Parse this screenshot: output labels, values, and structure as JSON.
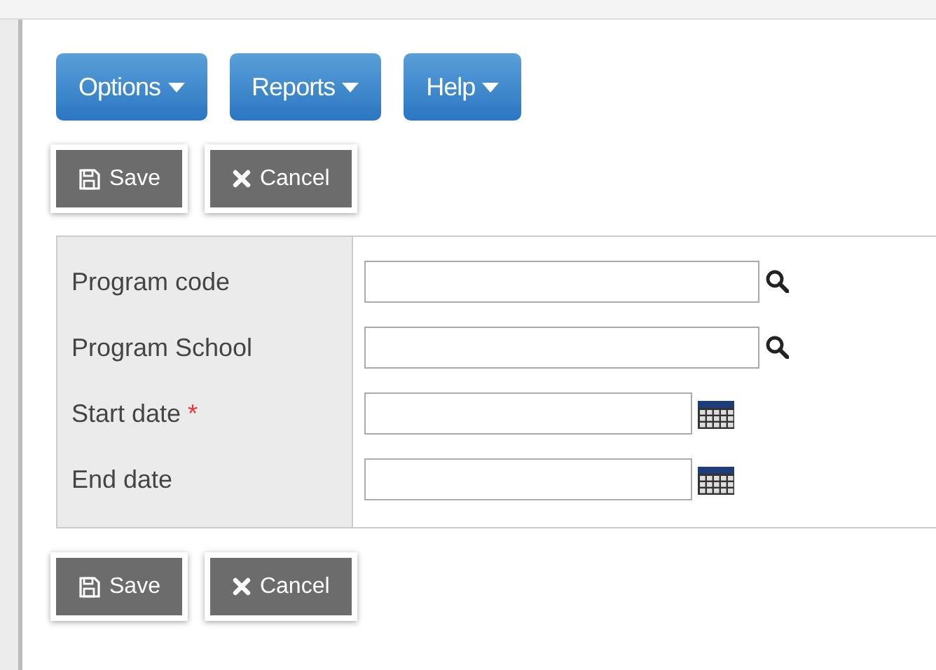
{
  "menus": [
    {
      "label": "Options"
    },
    {
      "label": "Reports"
    },
    {
      "label": "Help"
    }
  ],
  "required_mark": "*",
  "top_actions": [
    {
      "kind": "save",
      "label": "Save"
    },
    {
      "kind": "cancel",
      "label": "Cancel"
    }
  ],
  "fields": [
    {
      "label": "Program code",
      "kind": "lookup",
      "required": false
    },
    {
      "label": "Program School",
      "kind": "lookup",
      "required": false
    },
    {
      "label": "Start date",
      "kind": "date",
      "required": true
    },
    {
      "label": "End date",
      "kind": "date",
      "required": false
    }
  ],
  "bottom_actions": [
    {
      "kind": "save",
      "label": "Save"
    },
    {
      "kind": "cancel",
      "label": "Cancel"
    }
  ]
}
